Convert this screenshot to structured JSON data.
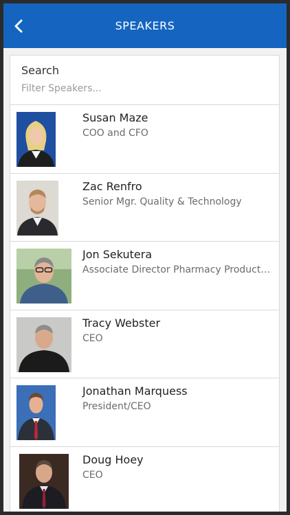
{
  "header": {
    "title": "SPEAKERS",
    "back_icon": "chevron-left-icon"
  },
  "search": {
    "label": "Search",
    "placeholder": "Filter Speakers..."
  },
  "colors": {
    "accent": "#1565c0",
    "background": "#f2f2f2"
  },
  "speakers": [
    {
      "name": "Susan Maze",
      "role": "COO and CFO"
    },
    {
      "name": "Zac Renfro",
      "role": "Senior Mgr. Quality & Technology"
    },
    {
      "name": "Jon Sekutera",
      "role": "Associate Director Pharmacy Products ..."
    },
    {
      "name": "Tracy Webster",
      "role": "CEO"
    },
    {
      "name": "Jonathan Marquess",
      "role": "President/CEO"
    },
    {
      "name": "Doug Hoey",
      "role": "CEO"
    }
  ]
}
